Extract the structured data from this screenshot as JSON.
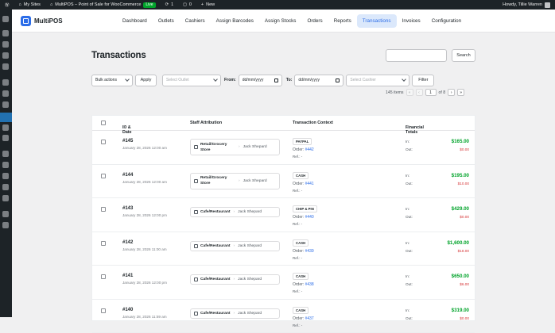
{
  "admin_bar": {
    "my_sites": "My Sites",
    "site_name": "MultiPOS – Point of Sale for WooCommerce",
    "live_badge": "Live",
    "updates_count": "1",
    "comments_count": "0",
    "new_label": "New",
    "greeting": "Howdy, Tillie Warren"
  },
  "app": {
    "name": "MultiPOS"
  },
  "nav": [
    "Dashboard",
    "Outlets",
    "Cashiers",
    "Assign Barcodes",
    "Assign Stocks",
    "Orders",
    "Reports",
    "Transactions",
    "Invoices",
    "Configuration"
  ],
  "nav_active": "Transactions",
  "page": {
    "title": "Transactions",
    "search_button": "Search"
  },
  "filters": {
    "bulk_actions": "Bulk actions",
    "apply": "Apply",
    "outlet_placeholder": "Select Outlet",
    "from_label": "From:",
    "from_placeholder": "dd/mm/yyyy",
    "to_label": "To:",
    "to_placeholder": "dd/mm/yyyy",
    "cashier_placeholder": "Select Cashier",
    "filter_button": "Filter"
  },
  "pagination": {
    "items": "145 items",
    "first": "«",
    "prev": "‹",
    "current_page": "1",
    "of_pages": "of 8",
    "next": "›",
    "last": "»"
  },
  "table": {
    "headers": {
      "id_date": "ID & Date",
      "staff": "Staff Attribution",
      "context": "Transaction Context",
      "totals": "Financial Totals"
    },
    "in_label": "In:",
    "out_label": "Out:",
    "order_label": "Order:",
    "ref_label": "Ref.: -",
    "rows": [
      {
        "id": "#145",
        "date": "January 28, 2026 12:00 am",
        "outlet": "Retail/Grocery Store",
        "cashier": "Jack Shepard",
        "payment": "PAYPAL",
        "order": "#442",
        "in": "$165.00",
        "out": "$0.00"
      },
      {
        "id": "#144",
        "date": "January 28, 2026 12:00 am",
        "outlet": "Retail/Grocery Store",
        "cashier": "Jack Shepard",
        "payment": "CASH",
        "order": "#441",
        "in": "$195.00",
        "out": "$10.00"
      },
      {
        "id": "#143",
        "date": "January 28, 2026 12:00 pm",
        "outlet": "Cafe/Restaurant",
        "cashier": "Jack Shepard",
        "payment": "CHIP & PIN",
        "order": "#440",
        "in": "$429.00",
        "out": "$0.00"
      },
      {
        "id": "#142",
        "date": "January 28, 2026 11:00 am",
        "outlet": "Cafe/Restaurant",
        "cashier": "Jack Shepard",
        "payment": "CASH",
        "order": "#439",
        "in": "$1,600.00",
        "out": "$18.00"
      },
      {
        "id": "#141",
        "date": "January 28, 2026 12:00 pm",
        "outlet": "Cafe/Restaurant",
        "cashier": "Jack Shepard",
        "payment": "CASH",
        "order": "#438",
        "in": "$650.00",
        "out": "$6.00"
      },
      {
        "id": "#140",
        "date": "January 28, 2026 11:59 am",
        "outlet": "Cafe/Restaurant",
        "cashier": "Jack Shepard",
        "payment": "CASH",
        "order": "#437",
        "in": "$319.00",
        "out": "$0.00"
      }
    ]
  }
}
